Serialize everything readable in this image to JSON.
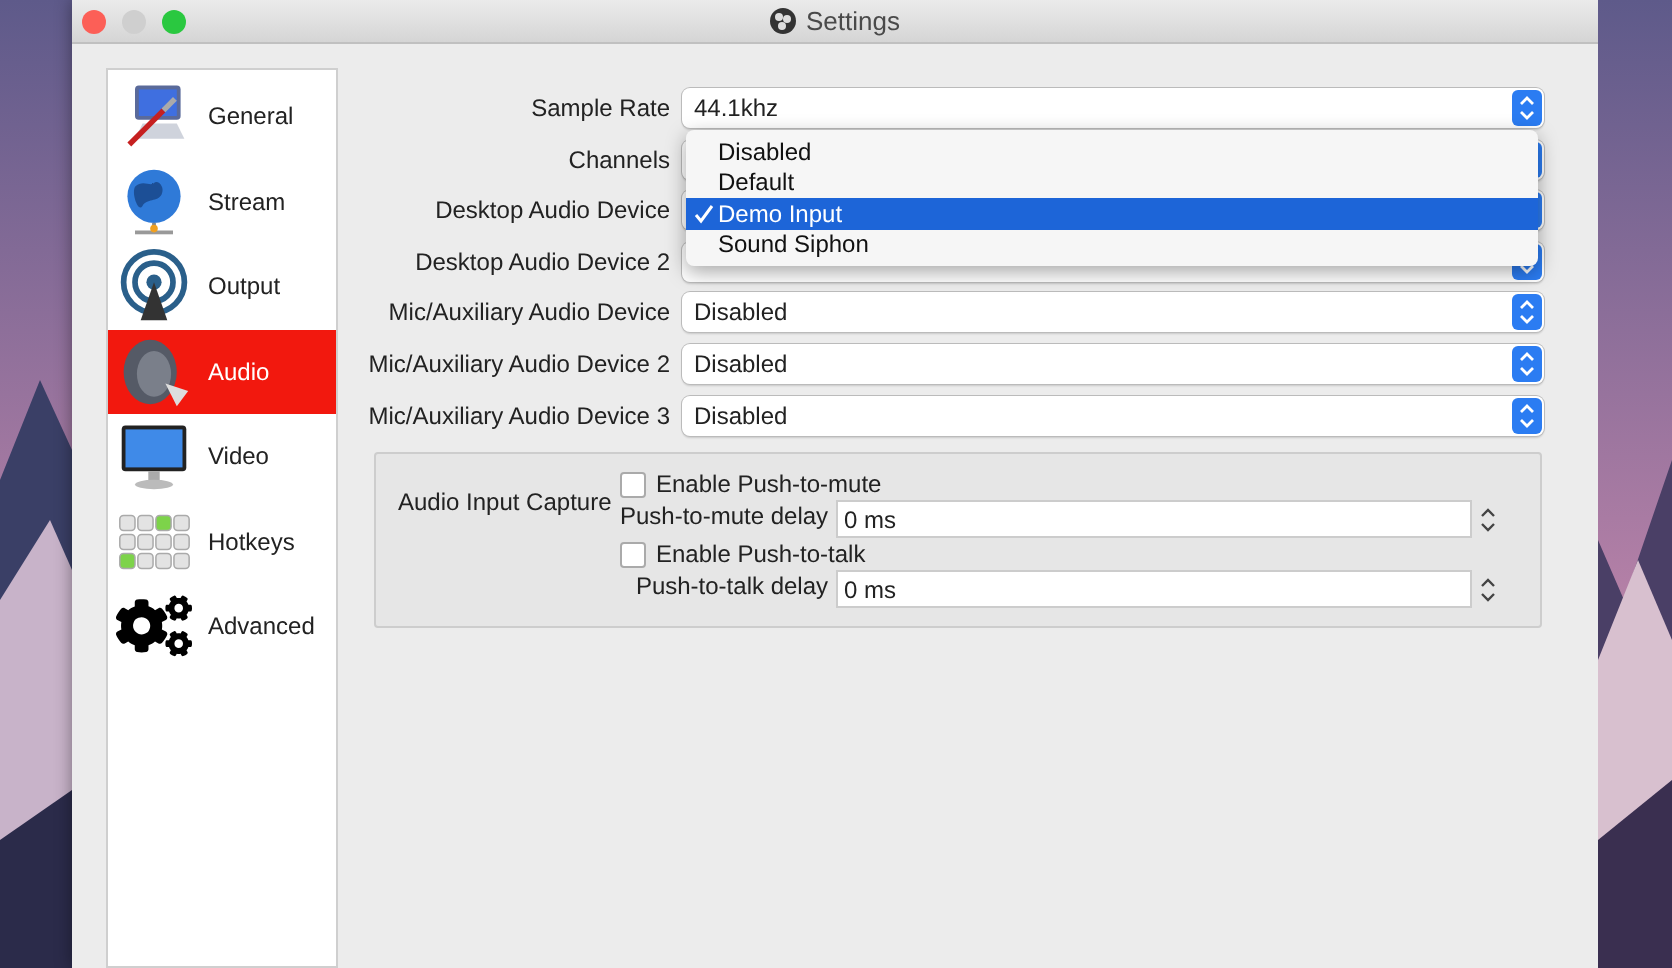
{
  "window": {
    "title": "Settings"
  },
  "sidebar": {
    "items": [
      {
        "label": "General",
        "selected": false
      },
      {
        "label": "Stream",
        "selected": false
      },
      {
        "label": "Output",
        "selected": false
      },
      {
        "label": "Audio",
        "selected": true
      },
      {
        "label": "Video",
        "selected": false
      },
      {
        "label": "Hotkeys",
        "selected": false
      },
      {
        "label": "Advanced",
        "selected": false
      }
    ]
  },
  "form": {
    "rows": [
      {
        "label": "Sample Rate",
        "value": "44.1khz"
      },
      {
        "label": "Channels"
      },
      {
        "label": "Desktop Audio Device"
      },
      {
        "label": "Desktop Audio Device 2"
      },
      {
        "label": "Mic/Auxiliary Audio Device",
        "value": "Disabled"
      },
      {
        "label": "Mic/Auxiliary Audio Device 2",
        "value": "Disabled"
      },
      {
        "label": "Mic/Auxiliary Audio Device 3",
        "value": "Disabled"
      }
    ]
  },
  "dropdown": {
    "items": [
      {
        "label": "Disabled",
        "selected": false
      },
      {
        "label": "Default",
        "selected": false
      },
      {
        "label": "Demo Input",
        "selected": true
      },
      {
        "label": "Sound Siphon",
        "selected": false
      }
    ]
  },
  "audio_input_capture": {
    "title": "Audio Input Capture",
    "items": [
      {
        "kind": "checkbox",
        "label": "Enable Push-to-mute",
        "checked": false
      },
      {
        "kind": "spin",
        "label": "Push-to-mute delay",
        "value": "0 ms"
      },
      {
        "kind": "checkbox",
        "label": "Enable Push-to-talk",
        "checked": false
      },
      {
        "kind": "spin",
        "label": "Push-to-talk delay",
        "value": "0 ms"
      }
    ]
  }
}
